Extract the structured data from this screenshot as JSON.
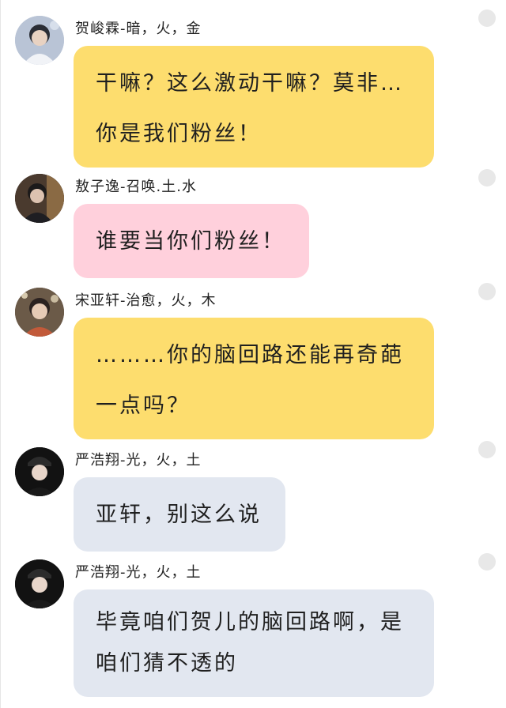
{
  "messages": [
    {
      "sender": "贺峻霖-暗，火，金",
      "lines": [
        "干嘛？这么激动干嘛？莫非…",
        "你是我们粉丝！"
      ],
      "bubble_color": "#fddd6e"
    },
    {
      "sender": "敖子逸-召唤.土.水",
      "lines": [
        "谁要当你们粉丝！"
      ],
      "bubble_color": "#ffd0dc"
    },
    {
      "sender": "宋亚轩-治愈，火，木",
      "lines": [
        "………你的脑回路还能再奇葩",
        "一点吗？"
      ],
      "bubble_color": "#fddd6e"
    },
    {
      "sender": "严浩翔-光，火，土",
      "lines": [
        "亚轩，别这么说"
      ],
      "bubble_color": "#e2e7f0"
    },
    {
      "sender": "严浩翔-光，火，土",
      "lines": [
        "毕竟咱们贺儿的脑回路啊，是",
        "咱们猜不透的"
      ],
      "bubble_color": "#e2e7f0"
    }
  ],
  "icons": {
    "avatar": "avatar-photo",
    "option_dot": "circle-icon"
  }
}
